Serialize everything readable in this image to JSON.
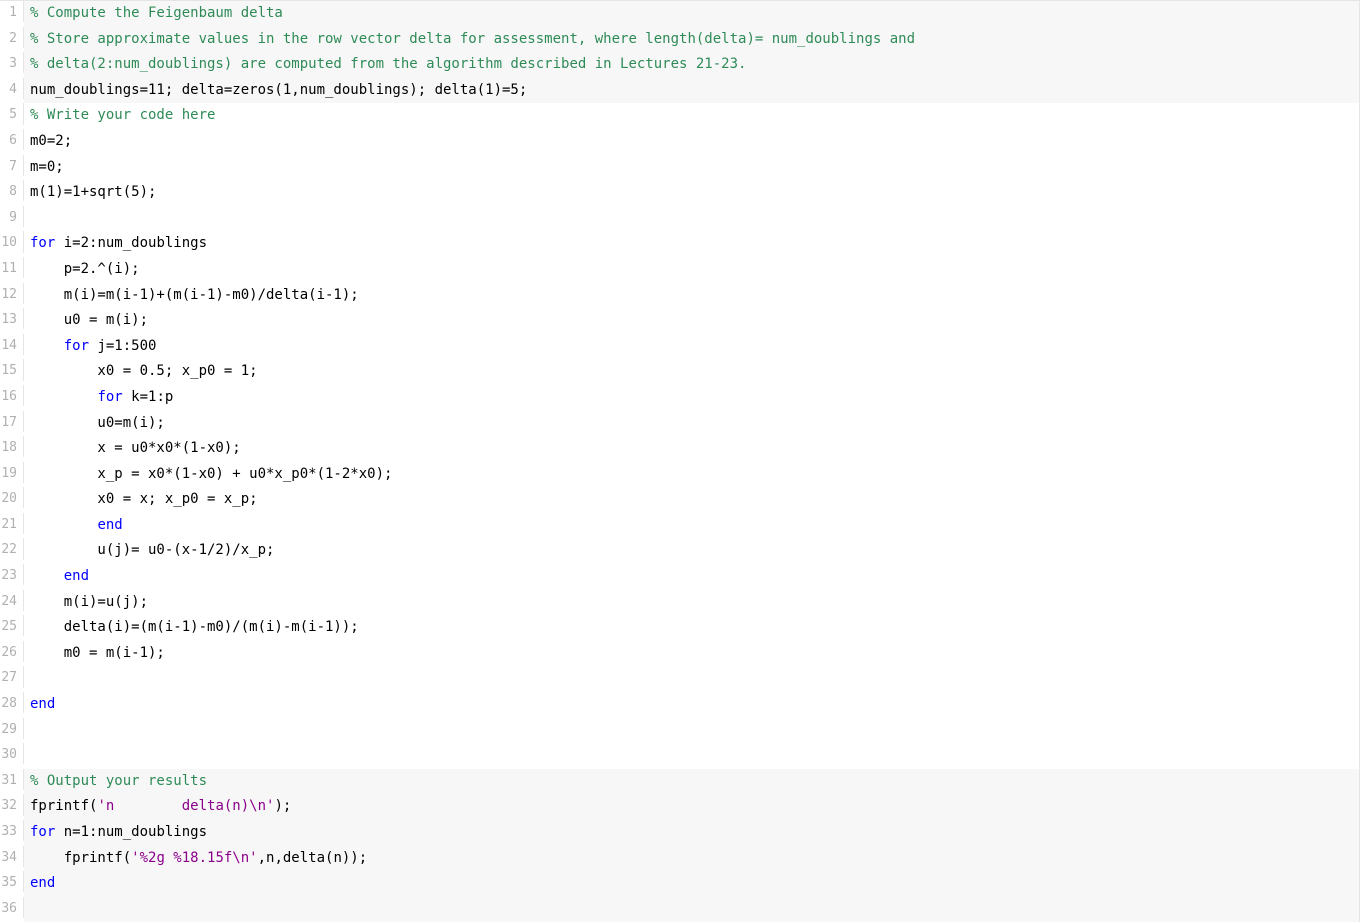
{
  "lines": [
    {
      "num": 1,
      "readonly": true,
      "tokens": [
        {
          "cls": "tok-comment",
          "text": "% Compute the Feigenbaum delta"
        }
      ]
    },
    {
      "num": 2,
      "readonly": true,
      "tokens": [
        {
          "cls": "tok-comment",
          "text": "% Store approximate values in the row vector delta for assessment, where length(delta)= num_doublings and"
        }
      ]
    },
    {
      "num": 3,
      "readonly": true,
      "tokens": [
        {
          "cls": "tok-comment",
          "text": "% delta(2:num_doublings) are computed from the algorithm described in Lectures 21-23."
        }
      ]
    },
    {
      "num": 4,
      "readonly": true,
      "tokens": [
        {
          "cls": "tok-default",
          "text": "num_doublings=11; delta=zeros(1,num_doublings); delta(1)=5;"
        }
      ]
    },
    {
      "num": 5,
      "readonly": false,
      "tokens": [
        {
          "cls": "tok-comment",
          "text": "% Write your code here"
        }
      ]
    },
    {
      "num": 6,
      "readonly": false,
      "tokens": [
        {
          "cls": "tok-default",
          "text": "m0=2;"
        }
      ]
    },
    {
      "num": 7,
      "readonly": false,
      "tokens": [
        {
          "cls": "tok-default",
          "text": "m=0;"
        }
      ]
    },
    {
      "num": 8,
      "readonly": false,
      "tokens": [
        {
          "cls": "tok-default",
          "text": "m(1)=1+sqrt(5);"
        }
      ]
    },
    {
      "num": 9,
      "readonly": false,
      "tokens": [
        {
          "cls": "tok-default",
          "text": ""
        }
      ]
    },
    {
      "num": 10,
      "readonly": false,
      "tokens": [
        {
          "cls": "tok-keyword",
          "text": "for"
        },
        {
          "cls": "tok-default",
          "text": " i=2:num_doublings"
        }
      ]
    },
    {
      "num": 11,
      "readonly": false,
      "tokens": [
        {
          "cls": "tok-default",
          "text": "    p=2.^(i);"
        }
      ]
    },
    {
      "num": 12,
      "readonly": false,
      "tokens": [
        {
          "cls": "tok-default",
          "text": "    m(i)=m(i-1)+(m(i-1)-m0)/delta(i-1);"
        }
      ]
    },
    {
      "num": 13,
      "readonly": false,
      "tokens": [
        {
          "cls": "tok-default",
          "text": "    u0 = m(i);"
        }
      ]
    },
    {
      "num": 14,
      "readonly": false,
      "tokens": [
        {
          "cls": "tok-default",
          "text": "    "
        },
        {
          "cls": "tok-keyword",
          "text": "for"
        },
        {
          "cls": "tok-default",
          "text": " j=1:500"
        }
      ]
    },
    {
      "num": 15,
      "readonly": false,
      "tokens": [
        {
          "cls": "tok-default",
          "text": "        x0 = 0.5; x_p0 = 1;"
        }
      ]
    },
    {
      "num": 16,
      "readonly": false,
      "tokens": [
        {
          "cls": "tok-default",
          "text": "        "
        },
        {
          "cls": "tok-keyword",
          "text": "for"
        },
        {
          "cls": "tok-default",
          "text": " k=1:p"
        }
      ]
    },
    {
      "num": 17,
      "readonly": false,
      "tokens": [
        {
          "cls": "tok-default",
          "text": "        u0=m(i);"
        }
      ]
    },
    {
      "num": 18,
      "readonly": false,
      "tokens": [
        {
          "cls": "tok-default",
          "text": "        x = u0*x0*(1-x0);"
        }
      ]
    },
    {
      "num": 19,
      "readonly": false,
      "tokens": [
        {
          "cls": "tok-default",
          "text": "        x_p = x0*(1-x0) + u0*x_p0*(1-2*x0);"
        }
      ]
    },
    {
      "num": 20,
      "readonly": false,
      "tokens": [
        {
          "cls": "tok-default",
          "text": "        x0 = x; x_p0 = x_p;"
        }
      ]
    },
    {
      "num": 21,
      "readonly": false,
      "tokens": [
        {
          "cls": "tok-default",
          "text": "        "
        },
        {
          "cls": "tok-keyword",
          "text": "end"
        }
      ]
    },
    {
      "num": 22,
      "readonly": false,
      "tokens": [
        {
          "cls": "tok-default",
          "text": "        u(j)= u0-(x-1/2)/x_p;"
        }
      ]
    },
    {
      "num": 23,
      "readonly": false,
      "tokens": [
        {
          "cls": "tok-default",
          "text": "    "
        },
        {
          "cls": "tok-keyword",
          "text": "end"
        }
      ]
    },
    {
      "num": 24,
      "readonly": false,
      "tokens": [
        {
          "cls": "tok-default",
          "text": "    m(i)=u(j);"
        }
      ]
    },
    {
      "num": 25,
      "readonly": false,
      "tokens": [
        {
          "cls": "tok-default",
          "text": "    delta(i)=(m(i-1)-m0)/(m(i)-m(i-1));"
        }
      ]
    },
    {
      "num": 26,
      "readonly": false,
      "tokens": [
        {
          "cls": "tok-default",
          "text": "    m0 = m(i-1);"
        }
      ]
    },
    {
      "num": 27,
      "readonly": false,
      "tokens": [
        {
          "cls": "tok-default",
          "text": ""
        }
      ]
    },
    {
      "num": 28,
      "readonly": false,
      "tokens": [
        {
          "cls": "tok-keyword",
          "text": "end"
        }
      ]
    },
    {
      "num": 29,
      "readonly": false,
      "tokens": [
        {
          "cls": "tok-default",
          "text": ""
        }
      ]
    },
    {
      "num": 30,
      "readonly": false,
      "tokens": [
        {
          "cls": "tok-default",
          "text": ""
        }
      ]
    },
    {
      "num": 31,
      "readonly": true,
      "tokens": [
        {
          "cls": "tok-comment",
          "text": "% Output your results"
        }
      ]
    },
    {
      "num": 32,
      "readonly": true,
      "tokens": [
        {
          "cls": "tok-default",
          "text": "fprintf("
        },
        {
          "cls": "tok-string",
          "text": "'n        delta(n)\\n'"
        },
        {
          "cls": "tok-default",
          "text": ");"
        }
      ]
    },
    {
      "num": 33,
      "readonly": true,
      "tokens": [
        {
          "cls": "tok-keyword",
          "text": "for"
        },
        {
          "cls": "tok-default",
          "text": " n=1:num_doublings"
        }
      ]
    },
    {
      "num": 34,
      "readonly": true,
      "tokens": [
        {
          "cls": "tok-default",
          "text": "    fprintf("
        },
        {
          "cls": "tok-string",
          "text": "'%2g %18.15f\\n'"
        },
        {
          "cls": "tok-default",
          "text": ",n,delta(n));"
        }
      ]
    },
    {
      "num": 35,
      "readonly": true,
      "tokens": [
        {
          "cls": "tok-keyword",
          "text": "end"
        }
      ]
    },
    {
      "num": 36,
      "readonly": true,
      "tokens": [
        {
          "cls": "tok-default",
          "text": ""
        }
      ]
    }
  ]
}
